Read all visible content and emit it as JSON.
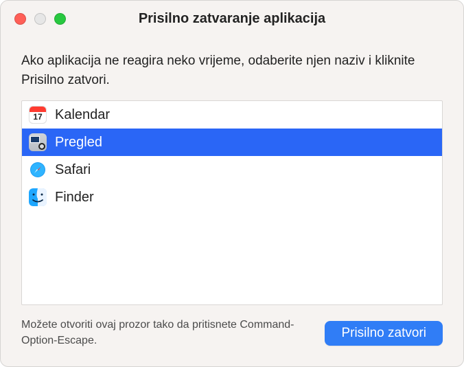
{
  "window": {
    "title": "Prisilno zatvaranje aplikacija"
  },
  "instructions": "Ako aplikacija ne reagira neko vrijeme, odaberite njen naziv i kliknite Prisilno zatvori.",
  "apps": [
    {
      "name": "Kalendar",
      "selected": false,
      "icon": "calendar"
    },
    {
      "name": "Pregled",
      "selected": true,
      "icon": "preview"
    },
    {
      "name": "Safari",
      "selected": false,
      "icon": "safari"
    },
    {
      "name": "Finder",
      "selected": false,
      "icon": "finder"
    }
  ],
  "calendar_day": "17",
  "hint": "Možete otvoriti ovaj prozor tako da pritisnete Command-Option-Escape.",
  "force_quit_label": "Prisilno zatvori"
}
